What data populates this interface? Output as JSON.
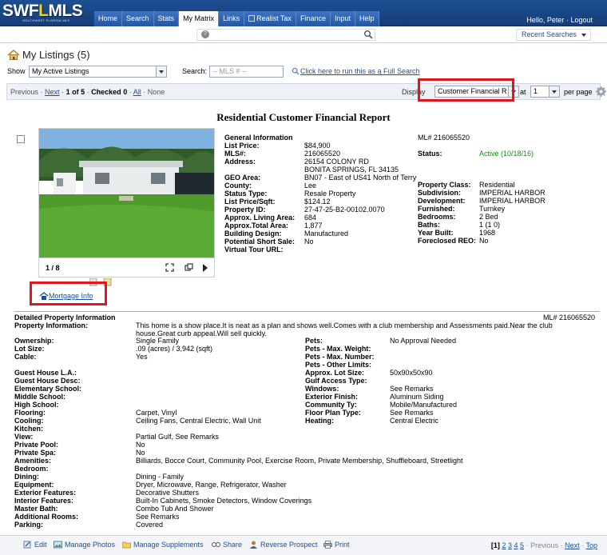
{
  "logo": {
    "text_main": "SWF",
    "text_accent": "L",
    "text_rest": "MLS",
    "sub": "SOUTHWEST FLORIDA MLS"
  },
  "nav": {
    "tabs": [
      "Home",
      "Search",
      "Stats",
      "My Matrix",
      "Links",
      "Realist Tax",
      "Finance",
      "Input",
      "Help"
    ],
    "active": "My Matrix"
  },
  "user": {
    "greeting": "Hello, Peter",
    "separator": "·",
    "logout": "Logout"
  },
  "search": {
    "recent": "Recent Searches"
  },
  "page": {
    "title": "My Listings (5)"
  },
  "filters": {
    "show_label": "Show",
    "show_value": "My Active Listings",
    "search_label": "Search:",
    "mls_placeholder": "-- MLS # --",
    "full_search": "Click here to run this as a Full Search"
  },
  "pager": {
    "previous": "Previous",
    "sep1": "·",
    "next": "Next",
    "sep2": "·",
    "range": "1 of 5",
    "sep3": "·",
    "checked_label": "Checked",
    "checked": "0",
    "sep4": "·",
    "all": "All",
    "sep5": "·",
    "none": "None",
    "display_label": "Display",
    "display_value": "Customer Financial R",
    "at_label": "at",
    "per_value": "1",
    "per_page_label": "per page"
  },
  "report": {
    "title": "Residential Customer Financial Report",
    "photo_count": "1 / 8",
    "mortgage_link": "Mortgage Info",
    "general_info": "General Information",
    "mls_top": "ML# 216065520",
    "left_fields": [
      {
        "k": "List Price:",
        "v": "$84,900"
      },
      {
        "k": "MLS#:",
        "v": "216065520"
      },
      {
        "k": "Address:",
        "v": "26154 COLONY RD"
      },
      {
        "k": "",
        "v": "BONITA SPRINGS, FL 34135"
      },
      {
        "k": "GEO Area:",
        "v": "BN07 - East of US41 North of Terry"
      },
      {
        "k": "County:",
        "v": "Lee"
      },
      {
        "k": "Status Type:",
        "v": "Resale Property"
      },
      {
        "k": "List Price/Sqft:",
        "v": "$124.12"
      },
      {
        "k": "Property ID:",
        "v": "27-47-25-B2-00102.0070"
      },
      {
        "k": "Approx. Living Area:",
        "v": "684"
      },
      {
        "k": "Approx.Total Area:",
        "v": "1,877"
      },
      {
        "k": "Building Design:",
        "v": "Manufactured"
      },
      {
        "k": "Potential Short Sale:",
        "v": "No"
      },
      {
        "k": "Virtual Tour URL:",
        "v": ""
      }
    ],
    "status": {
      "k": "Status:",
      "v": "Active (10/18/16)"
    },
    "right_fields": [
      {
        "k": "Property Class:",
        "v": "Residential"
      },
      {
        "k": "Subdivision:",
        "v": "IMPERIAL HARBOR"
      },
      {
        "k": "Development:",
        "v": "IMPERIAL HARBOR"
      },
      {
        "k": "Furnished:",
        "v": "Turnkey"
      },
      {
        "k": "Bedrooms:",
        "v": "2 Bed"
      },
      {
        "k": "Baths:",
        "v": "1 (1 0)"
      },
      {
        "k": "Year Built:",
        "v": "1968"
      },
      {
        "k": "Foreclosed REO:",
        "v": "No"
      }
    ],
    "detailed_title": "Detailed Property Information",
    "mls_detail": "ML# 216065520",
    "property_info_label": "Property Information:",
    "property_info_line1": "This home is a show place.It is neat as a plan and shows well.Comes with a club membership and Assessments paid.Near the club",
    "property_info_line2": "house.Great curb appeal.Will sell quickly.",
    "detail_left": [
      {
        "k": "Ownership:",
        "v": "Single Family"
      },
      {
        "k": "Lot Size:",
        "v": ".09 (acres) / 3,942 (sqft)"
      },
      {
        "k": "Cable:",
        "v": "Yes"
      },
      {
        "k": "",
        "v": ""
      },
      {
        "k": "Guest House L.A.:",
        "v": ""
      },
      {
        "k": "Guest House Desc:",
        "v": ""
      },
      {
        "k": "Elementary School:",
        "v": ""
      },
      {
        "k": "Middle School:",
        "v": ""
      },
      {
        "k": "High School:",
        "v": ""
      },
      {
        "k": "Flooring:",
        "v": "Carpet, Vinyl"
      },
      {
        "k": "Cooling:",
        "v": "Ceiling Fans, Central Electric, Wall Unit"
      },
      {
        "k": "Kitchen:",
        "v": ""
      },
      {
        "k": "View:",
        "v": "Partial Gulf, See Remarks"
      },
      {
        "k": "Private Pool:",
        "v": "No"
      },
      {
        "k": "Private Spa:",
        "v": "No"
      },
      {
        "k": "Amenities:",
        "v": "Billiards, Bocce Court, Community Pool, Exercise Room, Private Membership, Shuffleboard, Streetlight"
      },
      {
        "k": "Bedroom:",
        "v": ""
      },
      {
        "k": "Dining:",
        "v": "Dining - Family"
      },
      {
        "k": "Equipment:",
        "v": "Dryer, Microwave, Range, Refrigerator, Washer"
      },
      {
        "k": "Exterior Features:",
        "v": "Decorative Shutters"
      },
      {
        "k": "Interior Features:",
        "v": "Built-In Cabinets, Smoke Detectors, Window Coverings"
      },
      {
        "k": "Master Bath:",
        "v": "Combo Tub And Shower"
      },
      {
        "k": "Additional Rooms:",
        "v": "See Remarks"
      },
      {
        "k": "Parking:",
        "v": "Covered"
      }
    ],
    "detail_right": [
      {
        "k": "Pets:",
        "v": "No Approval Needed"
      },
      {
        "k": "Pets - Max. Weight:",
        "v": ""
      },
      {
        "k": "Pets - Max. Number:",
        "v": ""
      },
      {
        "k": "Pets - Other Limits:",
        "v": ""
      },
      {
        "k": "Approx. Lot Size:",
        "v": "50x90x50x90"
      },
      {
        "k": "Gulf Access Type:",
        "v": ""
      },
      {
        "k": "Windows:",
        "v": "See Remarks"
      },
      {
        "k": "Exterior Finish:",
        "v": "Aluminum Siding"
      },
      {
        "k": "Community Ty:",
        "v": "Mobile/Manufactured"
      },
      {
        "k": "Floor Plan Type:",
        "v": "See Remarks"
      },
      {
        "k": "Heating:",
        "v": "Central Electric"
      }
    ]
  },
  "footer": {
    "buttons": [
      "Edit",
      "Manage Photos",
      "Manage Supplements",
      "Share",
      "Reverse Prospect",
      "Print"
    ],
    "current_page": "[1]",
    "pages": [
      "2",
      "3",
      "4",
      "5"
    ],
    "sep": "·",
    "previous": "Previous",
    "next": "Next",
    "top": "Top"
  },
  "colors": {
    "nav_bar": "#1d4f93",
    "link": "#1a4f9c",
    "highlight": "#e2141d",
    "active_status": "#1a8a1a"
  },
  "icons": [
    "home-icon",
    "help-icon",
    "search-icon",
    "gear-icon",
    "expand-icon",
    "copy-icon",
    "next-arrow-icon",
    "mortgage-icon",
    "edit-icon",
    "photos-icon",
    "supplements-icon",
    "share-icon",
    "prospect-icon",
    "print-icon"
  ]
}
